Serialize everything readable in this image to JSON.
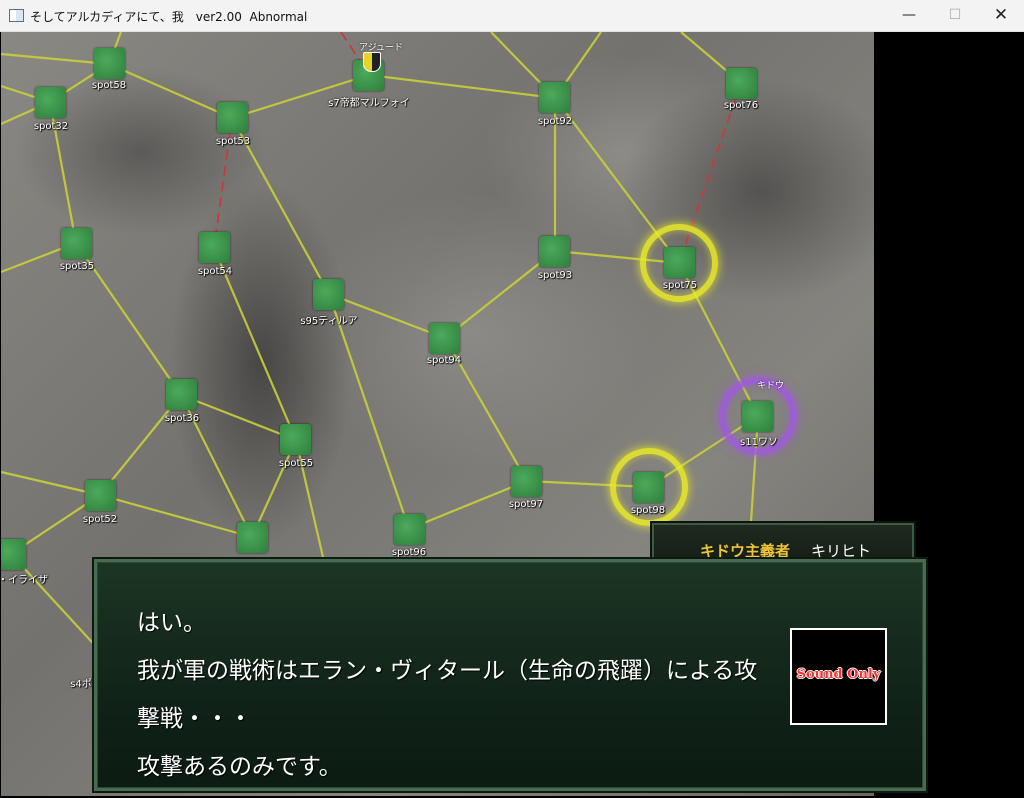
{
  "window": {
    "title": "そしてアルカディアにて、我　ver2.00  Abnormal",
    "minimize_glyph": "—",
    "maximize_glyph": "☐",
    "close_glyph": "✕"
  },
  "map": {
    "spots": {
      "spot58": "spot58",
      "spot32": "spot32",
      "s7": "s7帝都マルフォイ",
      "spot53": "spot53",
      "spot92": "spot92",
      "spot76": "spot76",
      "spot35": "spot35",
      "spot54": "spot54",
      "spot93": "spot93",
      "spot75": "spot75",
      "s95": "s95ティルア",
      "spot94": "spot94",
      "spot36": "spot36",
      "spot55": "spot55",
      "s11": "s11ワソ",
      "spot97": "spot97",
      "spot98": "spot98",
      "spot52": "spot52",
      "spot96": "spot96",
      "iraiza": "・イライザ",
      "s4": "s4ポ"
    },
    "unit_labels": {
      "s7_unit": "アジュード",
      "s11_unit": "キドウ"
    },
    "colors": {
      "road": "#c8d03a",
      "contested_road": "#c83a3a",
      "highlight_yellow": "#ebeb28",
      "highlight_purple": "#a05adc"
    }
  },
  "dialog": {
    "faction": "キドウ主義者",
    "speaker": "キリヒト",
    "lines": [
      "はい。",
      "我が軍の戦術はエラン・ヴィタール（生命の飛躍）による攻",
      "撃戦・・・",
      "攻撃あるのみです。"
    ],
    "portrait_text": "Sound Only"
  }
}
